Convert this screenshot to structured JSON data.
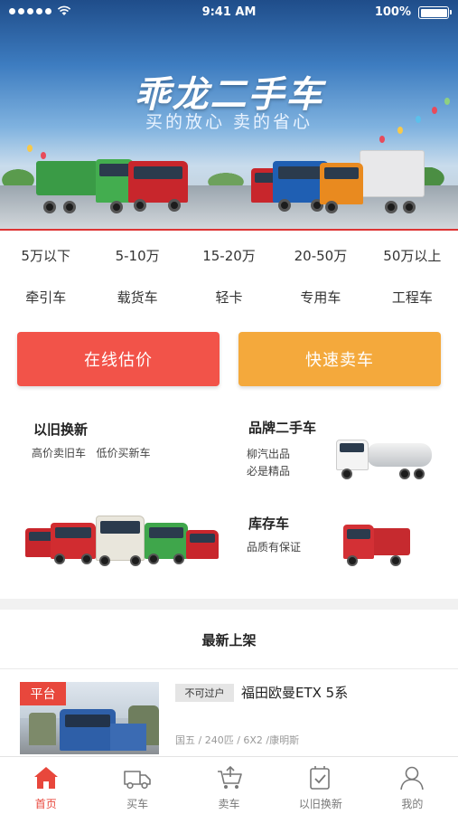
{
  "status_bar": {
    "time": "9:41 AM",
    "battery": "100%"
  },
  "banner": {
    "title": "乖龙二手车",
    "subtitle": "买的放心 卖的省心"
  },
  "price_filters": [
    "5万以下",
    "5-10万",
    "15-20万",
    "20-50万",
    "50万以上"
  ],
  "type_filters": [
    "牵引车",
    "载货车",
    "轻卡",
    "专用车",
    "工程车"
  ],
  "actions": {
    "estimate": "在线估价",
    "sell": "快速卖车"
  },
  "features": {
    "trade_in": {
      "title": "以旧换新",
      "text": "高价卖旧车   低价买新车"
    },
    "brand": {
      "title": "品牌二手车",
      "line1": "柳汽出品",
      "line2": "必是精品"
    },
    "stock": {
      "title": "库存车",
      "text": "品质有保证"
    }
  },
  "latest": {
    "title": "最新上架",
    "listing": {
      "badge": "平台",
      "tag": "不可过户",
      "name": "福田欧曼ETX 5系",
      "specs": "国五 / 240匹 / 6X2 /康明斯"
    }
  },
  "tabbar": [
    {
      "label": "首页",
      "icon": "home-icon",
      "active": true
    },
    {
      "label": "买车",
      "icon": "truck-icon",
      "active": false
    },
    {
      "label": "卖车",
      "icon": "cart-icon",
      "active": false
    },
    {
      "label": "以旧换新",
      "icon": "exchange-icon",
      "active": false
    },
    {
      "label": "我的",
      "icon": "user-icon",
      "active": false
    }
  ],
  "colors": {
    "primary_red": "#f25349",
    "orange": "#f4a93c",
    "active_tab": "#e8473c"
  }
}
